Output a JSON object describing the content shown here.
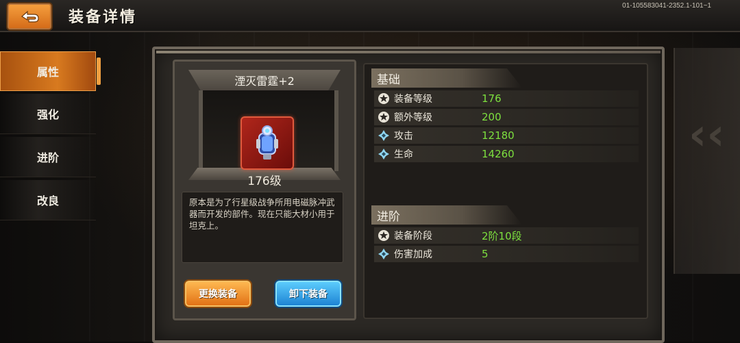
{
  "header": {
    "title": "装备详情",
    "version": "01-105583041-2352.1-101~1"
  },
  "sidebar": {
    "items": [
      {
        "label": "属性",
        "active": true
      },
      {
        "label": "强化",
        "active": false
      },
      {
        "label": "进阶",
        "active": false
      },
      {
        "label": "改良",
        "active": false
      }
    ]
  },
  "item": {
    "name": "湮灭雷霆+2",
    "level": "176级",
    "description": "原本是为了行星级战争所用电磁脉冲武器而开发的部件。现在只能大材小用于坦克上。",
    "icon": "energy-core-icon"
  },
  "buttons": {
    "replace": "更换装备",
    "unequip": "卸下装备"
  },
  "stats": {
    "basic": {
      "title": "基础",
      "rows": [
        {
          "label": "装备等级",
          "value": "176",
          "icon": "star-icon"
        },
        {
          "label": "额外等级",
          "value": "200",
          "icon": "star-icon"
        },
        {
          "label": "攻击",
          "value": "12180",
          "icon": "diamond-icon"
        },
        {
          "label": "生命",
          "value": "14260",
          "icon": "diamond-icon"
        }
      ]
    },
    "advance": {
      "title": "进阶",
      "rows": [
        {
          "label": "装备阶段",
          "value": "2阶10段",
          "icon": "star-icon"
        },
        {
          "label": "伤害加成",
          "value": "5",
          "icon": "diamond-icon"
        }
      ]
    }
  },
  "colors": {
    "accent": "#d87a1f",
    "value_green": "#7de03e",
    "button_blue": "#1a7fd1"
  }
}
